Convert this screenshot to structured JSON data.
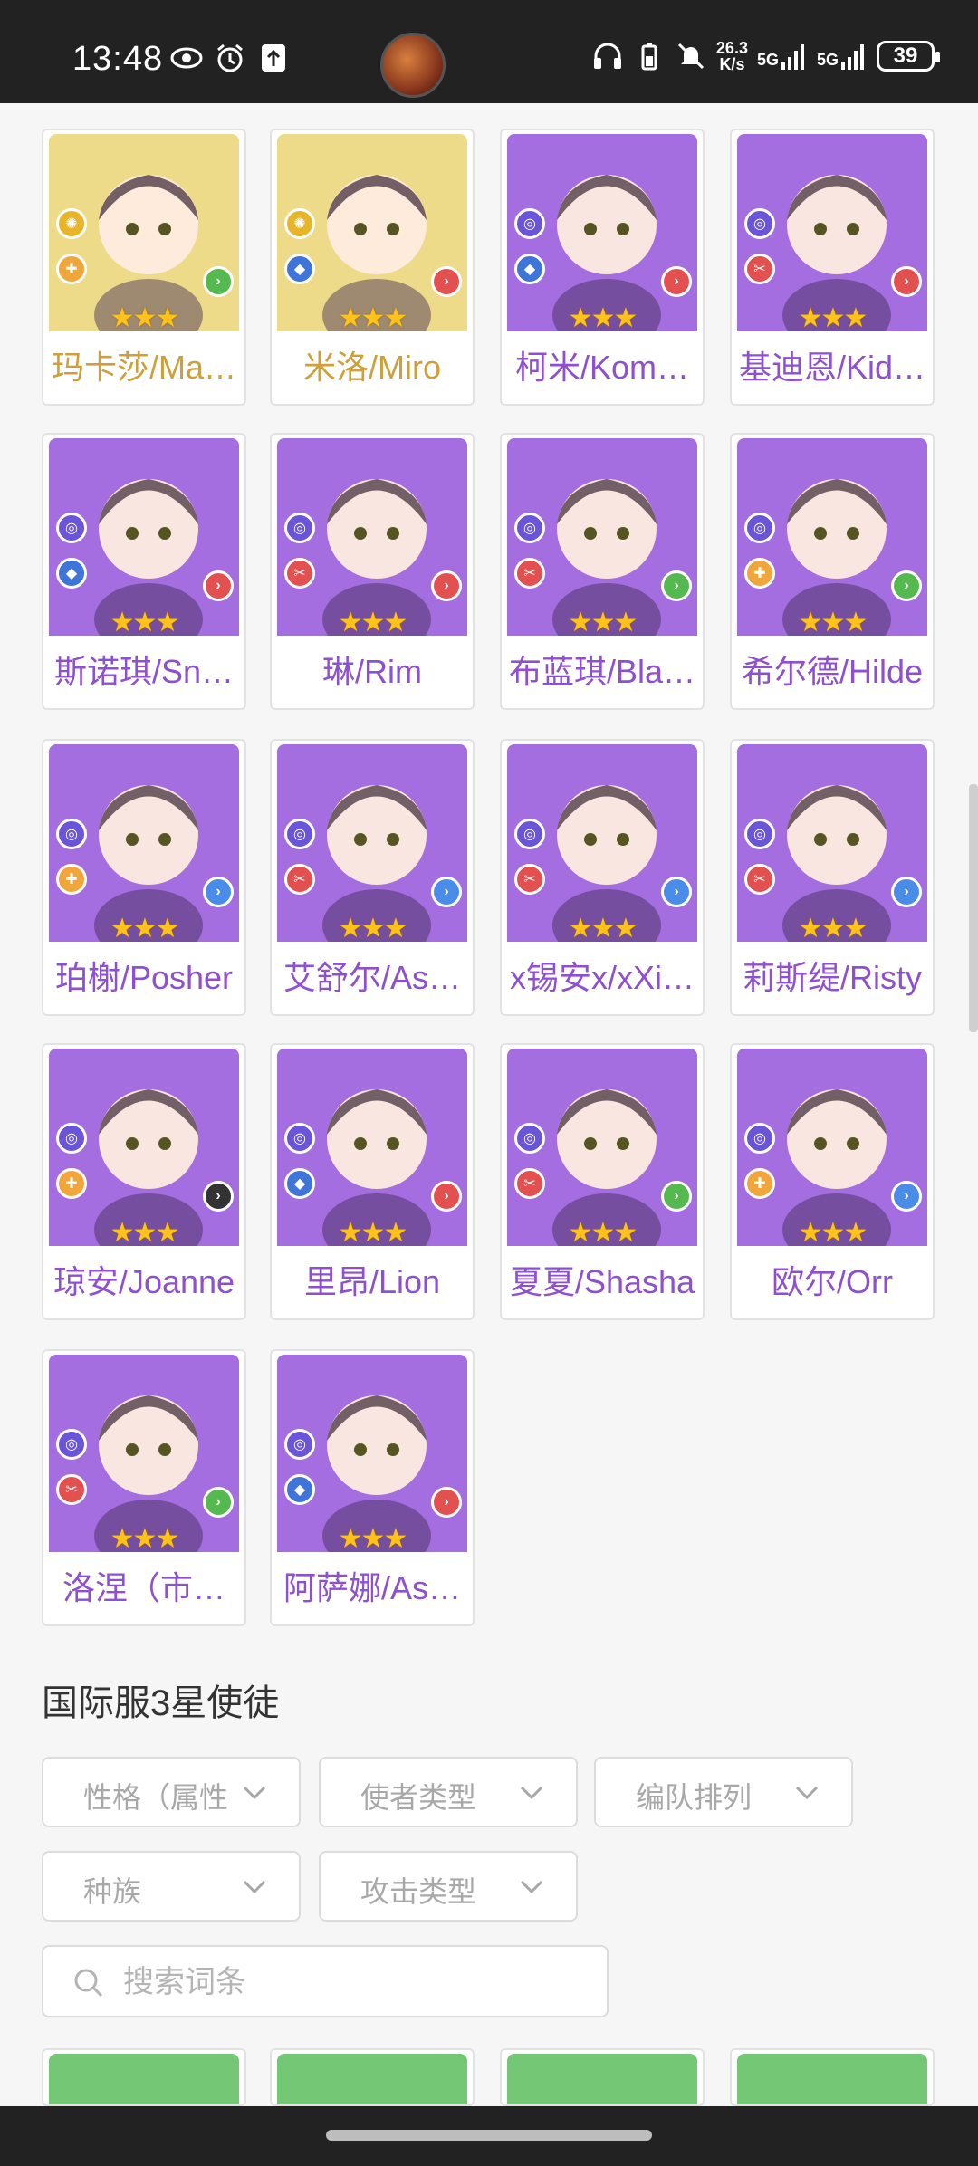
{
  "status_bar": {
    "time": "13:48",
    "net_speed_value": "26.3",
    "net_speed_unit": "K/s",
    "signal1": "5G",
    "signal2": "5G",
    "battery": "39",
    "icons": [
      "eye-icon",
      "alarm-icon",
      "upload-icon",
      "headphones-icon",
      "battery-saver-icon",
      "mute-icon"
    ]
  },
  "colors": {
    "purple_card": "#a46ee0",
    "gold_card": "#eedb8a",
    "green_card": "#74c774",
    "purple_name": "#8e4fd0",
    "gold_name": "#cfa039"
  },
  "characters": [
    {
      "name": "玛卡莎/Ma…",
      "rarity": "light",
      "name_color": "gold",
      "element": "light",
      "role": "heal",
      "position": "mid",
      "stars": "★★★"
    },
    {
      "name": "米洛/Miro",
      "rarity": "light",
      "name_color": "gold",
      "element": "light",
      "role": "def",
      "position": "front",
      "stars": "★★★"
    },
    {
      "name": "柯米/Kom…",
      "rarity": "purple",
      "name_color": "purple",
      "element": "dark",
      "role": "def",
      "position": "front",
      "stars": "★★★"
    },
    {
      "name": "基迪恩/Kid…",
      "rarity": "purple",
      "name_color": "purple",
      "element": "dark",
      "role": "atk",
      "position": "front",
      "stars": "★★★"
    },
    {
      "name": "斯诺琪/Sn…",
      "rarity": "purple",
      "name_color": "purple",
      "element": "dark",
      "role": "def",
      "position": "front",
      "stars": "★★★"
    },
    {
      "name": "琳/Rim",
      "rarity": "purple",
      "name_color": "purple",
      "element": "dark",
      "role": "atk",
      "position": "front",
      "stars": "★★★"
    },
    {
      "name": "布蓝琪/Bla…",
      "rarity": "purple",
      "name_color": "purple",
      "element": "dark",
      "role": "atk",
      "position": "mid",
      "stars": "★★★"
    },
    {
      "name": "希尔德/Hilde",
      "rarity": "purple",
      "name_color": "purple",
      "element": "dark",
      "role": "heal",
      "position": "mid",
      "stars": "★★★"
    },
    {
      "name": "珀榭/Posher",
      "rarity": "purple",
      "name_color": "purple",
      "element": "dark",
      "role": "heal",
      "position": "back",
      "stars": "★★★"
    },
    {
      "name": "艾舒尔/As…",
      "rarity": "purple",
      "name_color": "purple",
      "element": "dark",
      "role": "atk",
      "position": "back",
      "stars": "★★★"
    },
    {
      "name": "x锡安x/xXi…",
      "rarity": "purple",
      "name_color": "purple",
      "element": "dark",
      "role": "atk",
      "position": "back",
      "stars": "★★★"
    },
    {
      "name": "莉斯缇/Risty",
      "rarity": "purple",
      "name_color": "purple",
      "element": "dark",
      "role": "atk",
      "position": "back",
      "stars": "★★★"
    },
    {
      "name": "琼安/Joanne",
      "rarity": "purple",
      "name_color": "purple",
      "element": "dark",
      "role": "heal",
      "position": "dark",
      "stars": "★★★"
    },
    {
      "name": "里昂/Lion",
      "rarity": "purple",
      "name_color": "purple",
      "element": "dark",
      "role": "def",
      "position": "front",
      "stars": "★★★"
    },
    {
      "name": "夏夏/Shasha",
      "rarity": "purple",
      "name_color": "purple",
      "element": "dark",
      "role": "atk",
      "position": "mid",
      "stars": "★★★"
    },
    {
      "name": "欧尔/Orr",
      "rarity": "purple",
      "name_color": "purple",
      "element": "dark",
      "role": "heal",
      "position": "back",
      "stars": "★★★"
    },
    {
      "name": "洛涅（市…",
      "rarity": "purple",
      "name_color": "purple",
      "element": "dark",
      "role": "atk",
      "position": "mid",
      "stars": "★★★"
    },
    {
      "name": "阿萨娜/As…",
      "rarity": "purple",
      "name_color": "purple",
      "element": "dark",
      "role": "def",
      "position": "front",
      "stars": "★★★"
    }
  ],
  "section": {
    "title": "国际服3星使徒"
  },
  "filters": [
    {
      "label": "性格（属性"
    },
    {
      "label": "使者类型"
    },
    {
      "label": "编队排列"
    },
    {
      "label": "种族"
    },
    {
      "label": "攻击类型"
    }
  ],
  "search": {
    "placeholder": "搜索词条",
    "value": ""
  },
  "bottom_cards": [
    {
      "rarity": "green"
    },
    {
      "rarity": "green"
    },
    {
      "rarity": "green"
    },
    {
      "rarity": "green"
    }
  ]
}
